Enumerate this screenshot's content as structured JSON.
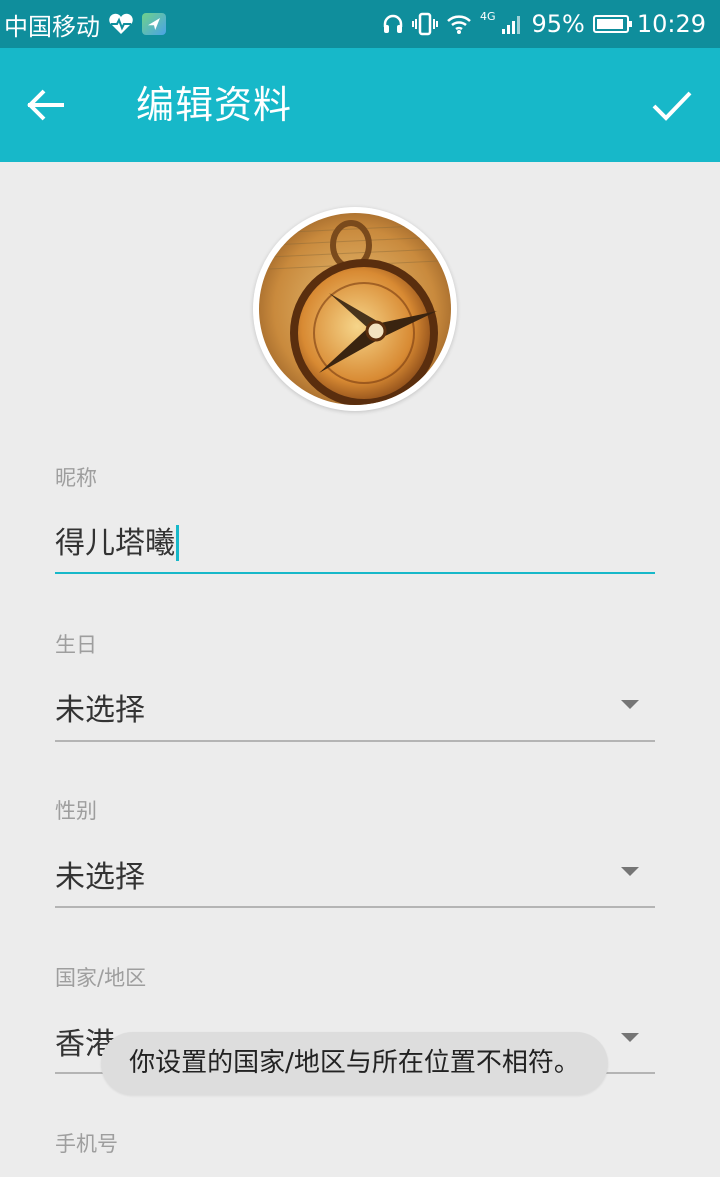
{
  "status_bar": {
    "carrier": "中国移动",
    "network": "4G",
    "battery": "95%",
    "battery_level": 0.95,
    "time": "10:29"
  },
  "header": {
    "title": "编辑资料",
    "background": "#17b8c9",
    "back_icon": "arrow-left-icon",
    "confirm_icon": "checkmark-icon"
  },
  "form": {
    "nickname": {
      "label": "昵称",
      "value": "得儿塔曦"
    },
    "birthday": {
      "label": "生日",
      "value": "未选择"
    },
    "gender": {
      "label": "性别",
      "value": "未选择"
    },
    "region": {
      "label": "国家/地区",
      "value": "香港"
    },
    "phone": {
      "label": "手机号"
    }
  },
  "toast": {
    "text": "你设置的国家/地区与所在位置不相符。"
  },
  "colors": {
    "accent": "#17b8c9",
    "status_bar": "#0f8e9c",
    "background": "#ececec"
  }
}
